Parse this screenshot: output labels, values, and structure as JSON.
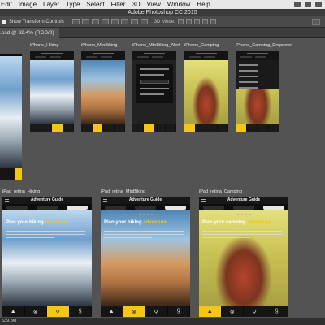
{
  "menu_bar": {
    "items": [
      "Edit",
      "Image",
      "Layer",
      "Type",
      "Select",
      "Filter",
      "3D",
      "View",
      "Window",
      "Help"
    ]
  },
  "title_bar": {
    "title": "Adobe Photoshop CC 2015"
  },
  "options_bar": {
    "show_transform_controls": "Show Transform Controls",
    "mode_3d_label": "3D Mode:"
  },
  "document_tab": {
    "label": ".psd @ 32.4% (RGB/8)"
  },
  "artboards": {
    "iphone_hiking": "iPhone_Hiking",
    "iphone_mtnbiking": "iPhone_MtnBiking",
    "iphone_mtnbiking_alert": "iPhone_MtnBiking_Alert",
    "iphone_camping": "iPhone_Camping",
    "iphone_camping_dropdown": "iPhone_Camping_Dropdown",
    "ipad_hiking": "iPad_retina_Hiking",
    "ipad_mtnbiking": "iPad_retina_MtnBiking",
    "ipad_camping": "iPad_retina_Camping"
  },
  "ipad_screens": {
    "header_title": "Adventure Guide",
    "headline_hiking_prefix": "Plan your hiking ",
    "headline_hiking_accent": "adventure",
    "headline_biking_prefix": "Plan your biking ",
    "headline_biking_accent": "adventure",
    "headline_camping_prefix": "Plan your camping ",
    "headline_camping_accent": "adventure"
  },
  "status_bar": {
    "zoom": "539.3M"
  },
  "colors": {
    "accent": "#f5c518",
    "canvas": "#535353"
  }
}
